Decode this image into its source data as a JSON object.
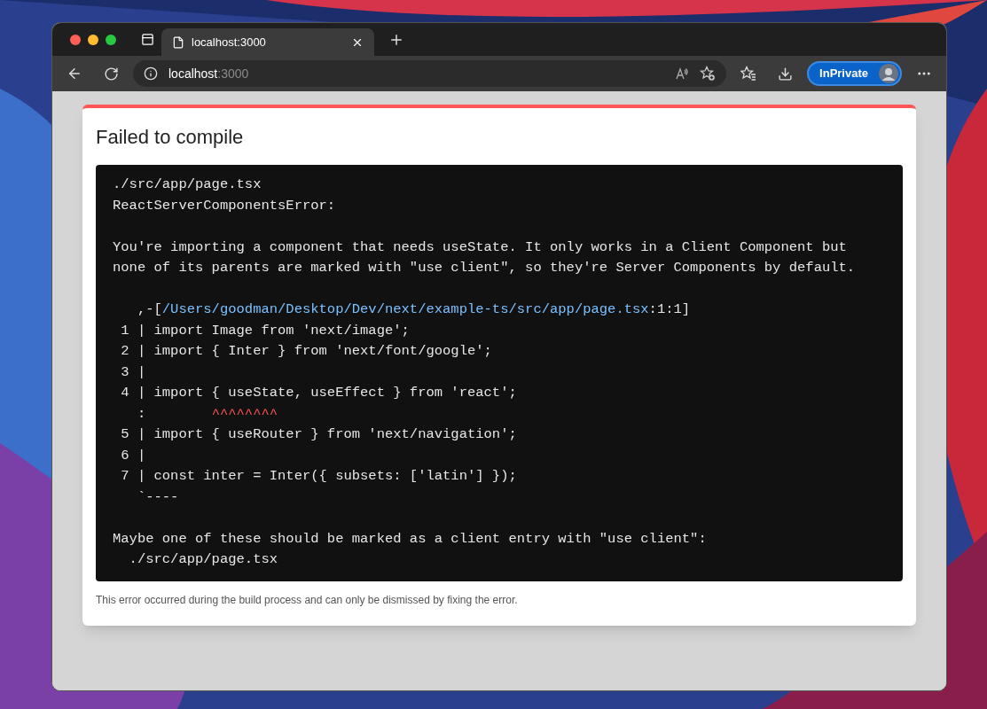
{
  "browser": {
    "tabs": [
      {
        "title": "localhost:3000",
        "selected": true
      }
    ],
    "address": {
      "host": "localhost",
      "port": ":3000"
    },
    "profile": {
      "label": "InPrivate"
    }
  },
  "error": {
    "title": "Failed to compile",
    "lines": [
      {
        "kind": "text",
        "segments": [
          {
            "kind": "plain",
            "text": "./src/app/page.tsx"
          }
        ]
      },
      {
        "kind": "text",
        "segments": [
          {
            "kind": "plain",
            "text": "ReactServerComponentsError:"
          }
        ]
      },
      {
        "kind": "blank"
      },
      {
        "kind": "text",
        "segments": [
          {
            "kind": "plain",
            "text": "You're importing a component that needs useState. It only works in a Client Component but"
          }
        ]
      },
      {
        "kind": "text",
        "segments": [
          {
            "kind": "plain",
            "text": "none of its parents are marked with \"use client\", so they're Server Components by default."
          }
        ]
      },
      {
        "kind": "blank"
      },
      {
        "kind": "text",
        "segments": [
          {
            "kind": "plain",
            "text": "   ,-["
          },
          {
            "kind": "link",
            "text": "/Users/goodman/Desktop/Dev/next/example-ts/src/app/page.tsx"
          },
          {
            "kind": "plain",
            "text": ":1:1]"
          }
        ]
      },
      {
        "kind": "text",
        "segments": [
          {
            "kind": "plain",
            "text": " 1 | import Image from 'next/image';"
          }
        ]
      },
      {
        "kind": "text",
        "segments": [
          {
            "kind": "plain",
            "text": " 2 | import { Inter } from 'next/font/google';"
          }
        ]
      },
      {
        "kind": "text",
        "segments": [
          {
            "kind": "plain",
            "text": " 3 |"
          }
        ]
      },
      {
        "kind": "text",
        "segments": [
          {
            "kind": "plain",
            "text": " 4 | import { useState, useEffect } from 'react';"
          }
        ]
      },
      {
        "kind": "text",
        "segments": [
          {
            "kind": "plain",
            "text": "   :"
          },
          {
            "kind": "squiggle",
            "text": "^^^^^^^^"
          }
        ]
      },
      {
        "kind": "text",
        "segments": [
          {
            "kind": "plain",
            "text": " 5 | import { useRouter } from 'next/navigation';"
          }
        ]
      },
      {
        "kind": "text",
        "segments": [
          {
            "kind": "plain",
            "text": " 6 |"
          }
        ]
      },
      {
        "kind": "text",
        "segments": [
          {
            "kind": "plain",
            "text": " 7 | const inter = Inter({ subsets: ['latin'] });"
          }
        ]
      },
      {
        "kind": "text",
        "segments": [
          {
            "kind": "plain",
            "text": "   `----"
          }
        ]
      },
      {
        "kind": "blank"
      },
      {
        "kind": "text",
        "segments": [
          {
            "kind": "plain",
            "text": "Maybe one of these should be marked as a client entry with \"use client\":"
          }
        ]
      },
      {
        "kind": "text",
        "segments": [
          {
            "kind": "plain",
            "text": "  ./src/app/page.tsx"
          }
        ]
      }
    ],
    "footer": "This error occurred during the build process and can only be dismissed by fixing the error."
  }
}
